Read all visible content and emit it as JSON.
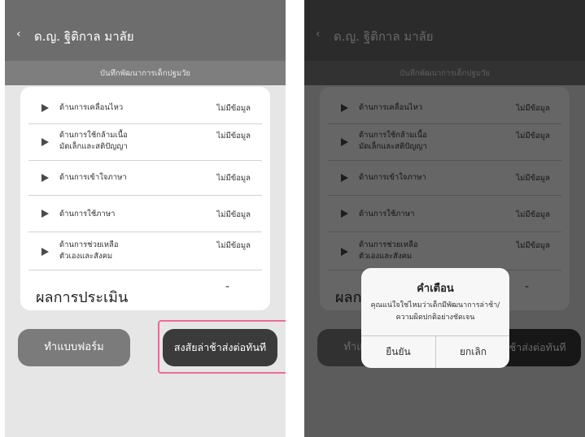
{
  "header": {
    "back_glyph": "‹",
    "title": "ด.ญ. ฐิติกาล มาลัย",
    "subtitle": "บันทึกพัฒนาการเด็กปฐมวัย"
  },
  "rows": [
    {
      "label_l1": "ด้านการเคลื่อนไหว",
      "label_l2": "",
      "status": "ไม่มีข้อมูล",
      "icon": "play-arrow-icon"
    },
    {
      "label_l1": "ด้านการใช้กล้ามเนื้อ",
      "label_l2": "มัดเล็กและสติปัญญา",
      "status": "ไม่มีข้อมูล",
      "icon": "play-arrow-icon"
    },
    {
      "label_l1": "ด้านการเข้าใจภาษา",
      "label_l2": "",
      "status": "ไม่มีข้อมูล",
      "icon": "play-arrow-icon"
    },
    {
      "label_l1": "ด้านการใช้ภาษา",
      "label_l2": "",
      "status": "ไม่มีข้อมูล",
      "icon": "play-arrow-icon"
    },
    {
      "label_l1": "ด้านการช่วยเหลือ",
      "label_l2": "ตัวเองและสังคม",
      "status": "ไม่มีข้อมูล",
      "icon": "play-arrow-icon"
    }
  ],
  "result": {
    "label": "ผลการประเมิน",
    "value": "-"
  },
  "buttons": {
    "form": "ทำแบบฟอร์ม",
    "refer": "สงสัยล่าช้าส่งต่อทันที"
  },
  "dialog": {
    "title": "คำเตือน",
    "message_l1": "คุณแน่ใจใช่ไหมว่าเด็กมีพัฒนาการล่าช้า/",
    "message_l2": "ความผิดปกติอย่างชัดเจน",
    "confirm": "ยืนยัน",
    "cancel": "ยกเลิก"
  },
  "colors": {
    "header": "#6d6d6d",
    "subheader": "#7e7e7e",
    "highlight": "#e0709b",
    "dark_button": "#3b3b3b"
  }
}
